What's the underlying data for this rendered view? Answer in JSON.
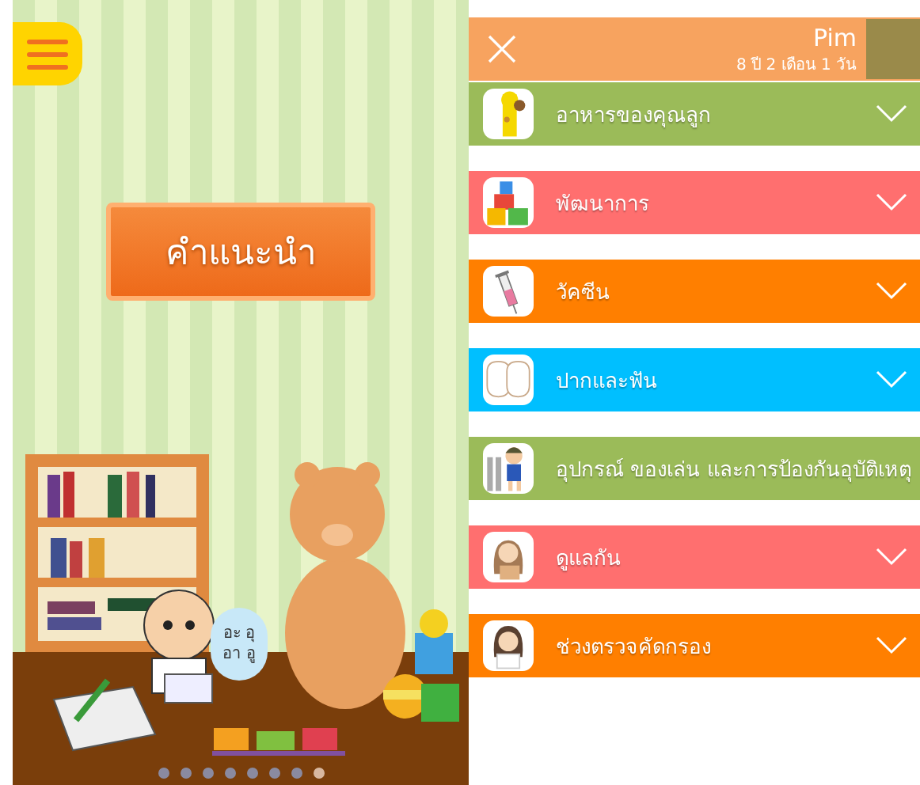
{
  "home": {
    "advice_button": "คำแนะนำ",
    "speech_bubble": [
      "อะ อุ",
      "อา อู"
    ],
    "page_dots": [
      {
        "selected": false
      },
      {
        "selected": false
      },
      {
        "selected": false
      },
      {
        "selected": false
      },
      {
        "selected": false
      },
      {
        "selected": false
      },
      {
        "selected": false
      },
      {
        "selected": true
      }
    ]
  },
  "menu": {
    "profile": {
      "name": "Pim",
      "age": "8 ปี 2 เดือน 1 วัน"
    },
    "items": [
      {
        "label": "อาหารของคุณลูก",
        "color": "#9bbb59",
        "chevron": true
      },
      {
        "label": "พัฒนาการ",
        "color": "#ff6f6f",
        "chevron": true
      },
      {
        "label": "วัคซีน",
        "color": "#ff7f00",
        "chevron": true
      },
      {
        "label": "ปากและฟัน",
        "color": "#00bfff",
        "chevron": true
      },
      {
        "label": "อุปกรณ์ ของเล่น และการป้องกันอุบัติเหตุ",
        "color": "#9bbb59",
        "chevron": false
      },
      {
        "label": "ดูแลกัน",
        "color": "#ff6f6f",
        "chevron": true
      },
      {
        "label": "ช่วงตรวจคัดกรอง",
        "color": "#ff7f00",
        "chevron": true
      }
    ]
  }
}
